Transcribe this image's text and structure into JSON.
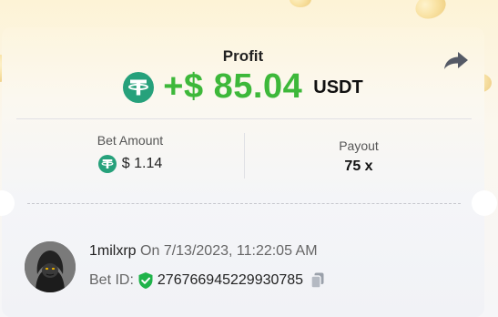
{
  "colors": {
    "profit_green": "#3db83a",
    "tether_green": "#26a17b",
    "shield_green": "#1fb34a",
    "icon_gray": "#555a66"
  },
  "header": {
    "title": "Profit",
    "share_icon": "share-arrow-icon"
  },
  "profit": {
    "currency_icon": "tether-icon",
    "amount": "+$ 85.04",
    "currency": "USDT"
  },
  "stats": {
    "bet_amount": {
      "label": "Bet Amount",
      "currency_icon": "tether-icon",
      "value": "$ 1.14"
    },
    "payout": {
      "label": "Payout",
      "value": "75 x"
    }
  },
  "player": {
    "avatar_icon": "avatar",
    "username": "1milxrp",
    "on_word": "On",
    "datetime": "7/13/2023, 11:22:05 AM",
    "bet_id_label": "Bet ID:",
    "verified_icon": "verified-shield-icon",
    "bet_id": "276766945229930785",
    "copy_icon": "copy-icon"
  }
}
